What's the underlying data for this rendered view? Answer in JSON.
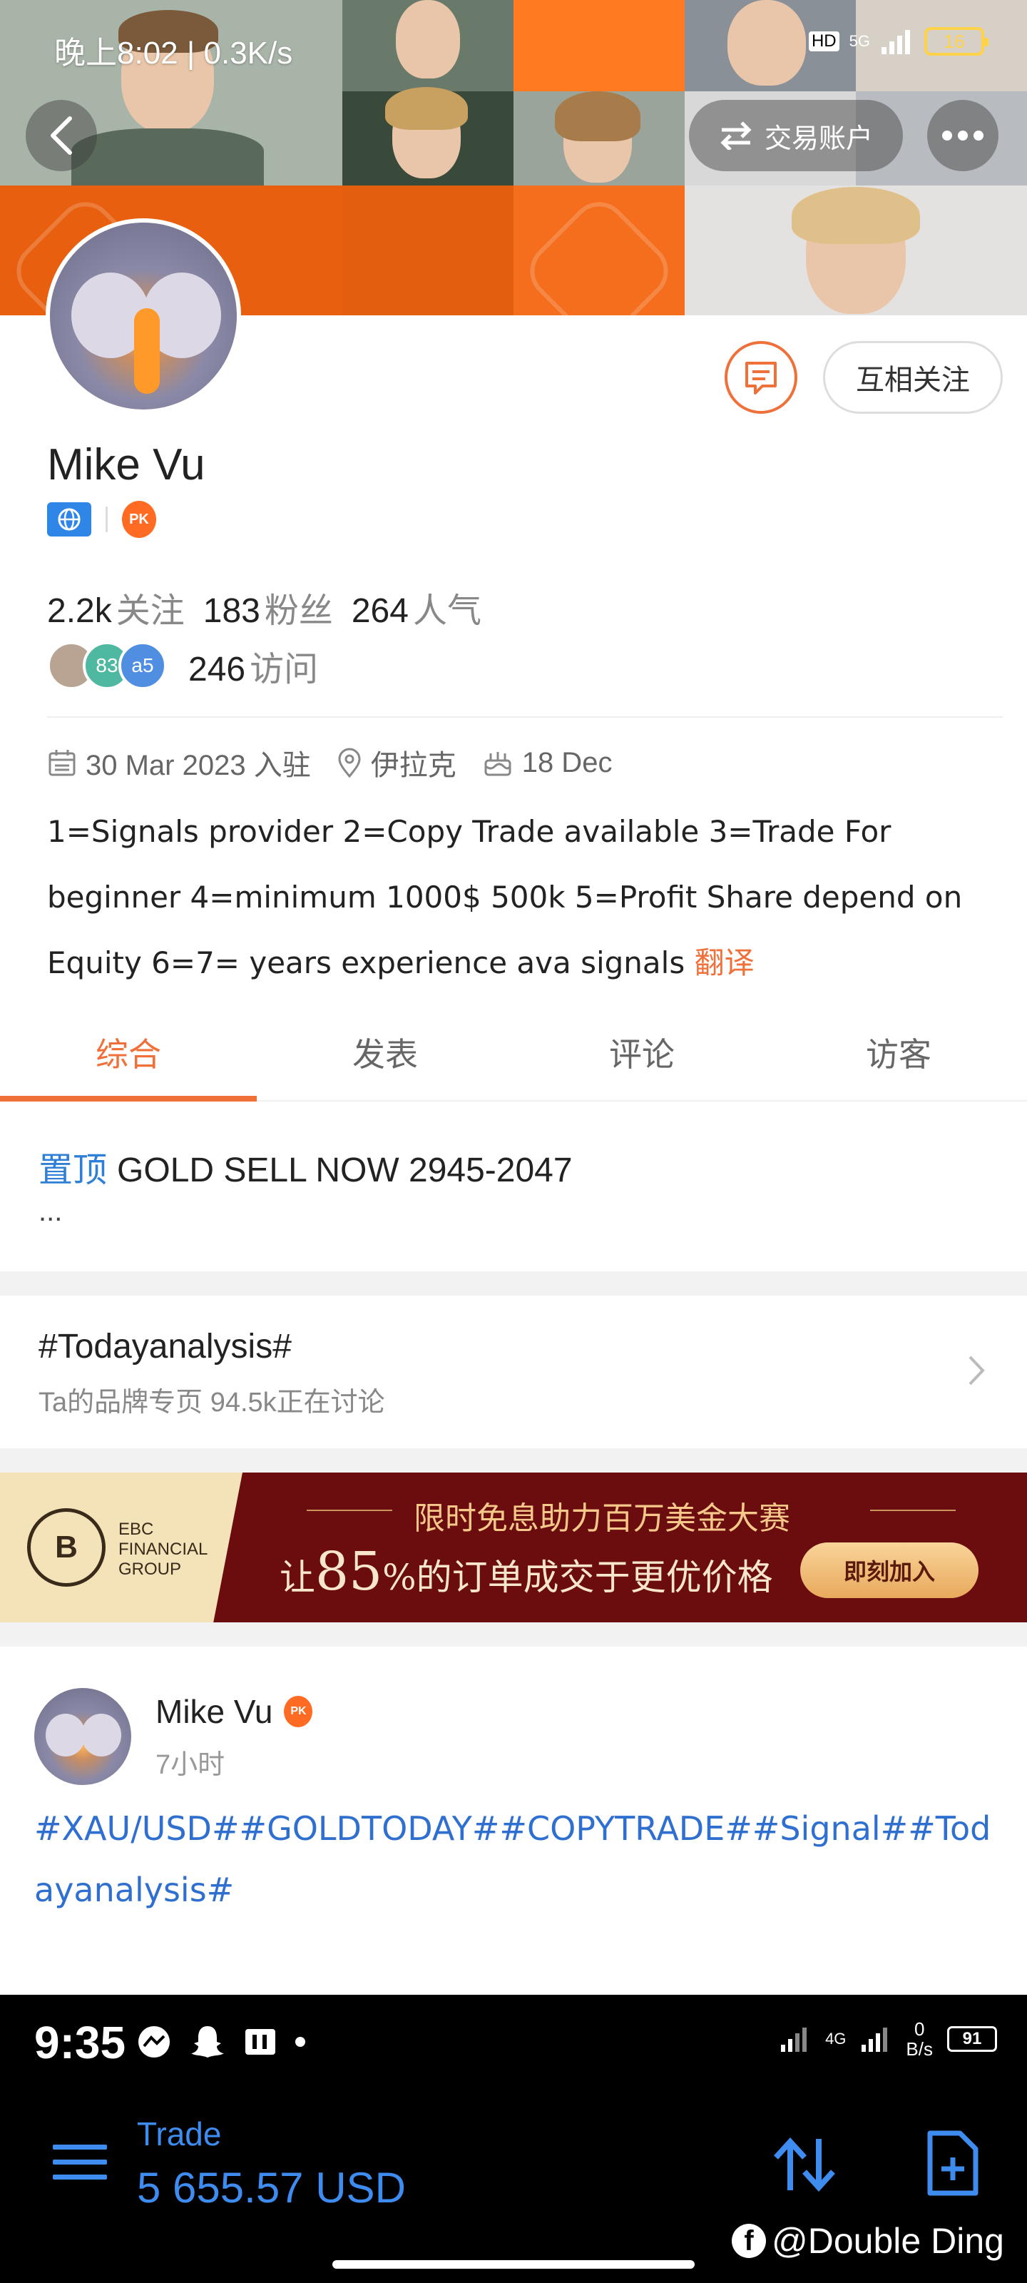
{
  "status_bar_top": {
    "text": "晚上8:02 | 0.3K/s",
    "network": "5G",
    "hd": "HD",
    "battery": "16"
  },
  "header": {
    "trade_account_label": "交易账户"
  },
  "profile": {
    "name": "Mike Vu",
    "follow_label": "互相关注",
    "stats": {
      "following_value": "2.2k",
      "following_label": "关注",
      "followers_value": "183",
      "followers_label": "粉丝",
      "popularity_value": "264",
      "popularity_label": "人气"
    },
    "visitors": {
      "avatars": [
        "",
        "83",
        "a5"
      ],
      "count": "246",
      "label": "访问"
    },
    "joined": "30 Mar 2023 入驻",
    "location": "伊拉克",
    "birthday": "18 Dec",
    "bio": "1=Signals provider 2=Copy Trade available 3=Trade For beginner 4=minimum 1000$ 500k 5=Profit Share depend on Equity 6=7= years experience ava signals",
    "translate": "翻译",
    "pk_badge": "PK"
  },
  "tabs": [
    {
      "label": "综合",
      "active": true
    },
    {
      "label": "发表",
      "active": false
    },
    {
      "label": "评论",
      "active": false
    },
    {
      "label": "访客",
      "active": false
    }
  ],
  "pinned": {
    "tag": "置顶",
    "title": "GOLD SELL NOW 2945-2047",
    "ellipsis": "..."
  },
  "topic": {
    "title": "#Todayanalysis#",
    "subtitle": "Ta的品牌专页   94.5k正在讨论"
  },
  "ad": {
    "brand_lines": [
      "EBC",
      "FINANCIAL",
      "GROUP"
    ],
    "headline": "限时免息助力百万美金大赛",
    "main_prefix": "让",
    "main_number": "85",
    "main_suffix": "%的订单成交于更优价格",
    "cta": "即刻加入"
  },
  "post": {
    "author": "Mike Vu",
    "time": "7小时",
    "text": "#XAU/USD##GOLDTODAY##COPYTRADE##Signal##Todayanalysis#"
  },
  "bottom_app": {
    "time": "9:35",
    "network": "4G",
    "speed_value": "0",
    "speed_unit": "B/s",
    "battery": "91",
    "trade_label": "Trade",
    "balance": "5 655.57 USD",
    "watermark": "@Double Ding"
  },
  "colors": {
    "accent": "#f0703a",
    "link": "#2f6fd0",
    "trade_blue": "#3f8cf0"
  }
}
